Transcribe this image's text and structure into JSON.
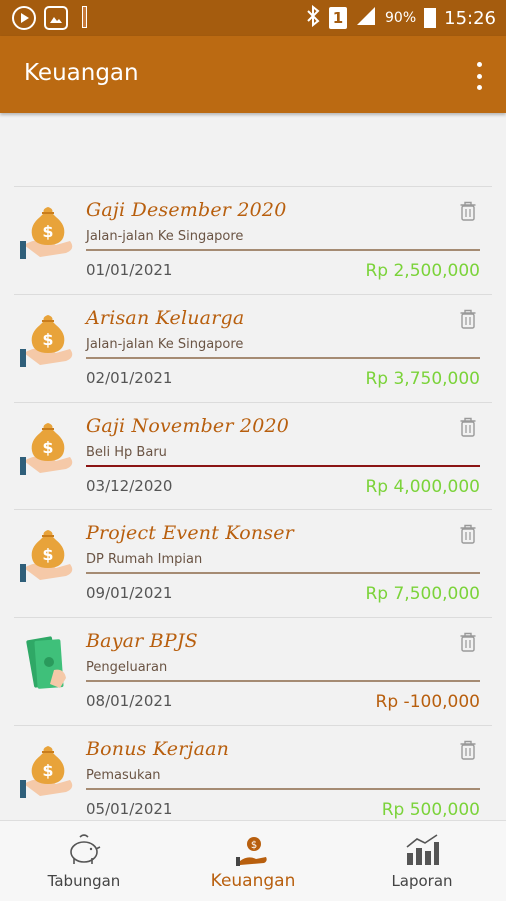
{
  "status_bar": {
    "battery_pct": "90%",
    "time": "15:26",
    "sim_label": "1"
  },
  "app_bar": {
    "title": "Keuangan"
  },
  "transactions": [
    {
      "title": "Gaji Desember 2020",
      "category": "Jalan-jalan Ke Singapore",
      "date": "01/01/2021",
      "amount": "Rp 2,500,000",
      "type": "income",
      "icon": "money-bag-icon"
    },
    {
      "title": "Arisan Keluarga",
      "category": "Jalan-jalan Ke Singapore",
      "date": "02/01/2021",
      "amount": "Rp 3,750,000",
      "type": "income",
      "icon": "money-bag-icon"
    },
    {
      "title": "Gaji November 2020",
      "category": "Beli Hp Baru",
      "date": "03/12/2020",
      "amount": "Rp 4,000,000",
      "type": "income",
      "icon": "money-bag-icon"
    },
    {
      "title": "Project Event Konser",
      "category": "DP Rumah Impian",
      "date": "09/01/2021",
      "amount": "Rp 7,500,000",
      "type": "income",
      "icon": "money-bag-icon"
    },
    {
      "title": "Bayar BPJS",
      "category": "Pengeluaran",
      "date": "08/01/2021",
      "amount": "Rp -100,000",
      "type": "expense",
      "icon": "cash-hand-icon"
    },
    {
      "title": "Bonus Kerjaan",
      "category": "Pemasukan",
      "date": "05/01/2021",
      "amount": "Rp 500,000",
      "type": "income",
      "icon": "money-bag-icon"
    }
  ],
  "bottom_nav": [
    {
      "label": "Tabungan",
      "icon": "piggy-bank-icon",
      "active": false
    },
    {
      "label": "Keuangan",
      "icon": "money-hand-icon",
      "active": true
    },
    {
      "label": "Laporan",
      "icon": "bar-chart-icon",
      "active": false
    }
  ],
  "colors": {
    "status_bar": "#a55c0e",
    "app_bar": "#bb6a12",
    "title_text": "#b85f0e",
    "income_amount": "#7bd33a",
    "expense_amount": "#b85f0e",
    "divider": "#a58b73"
  }
}
